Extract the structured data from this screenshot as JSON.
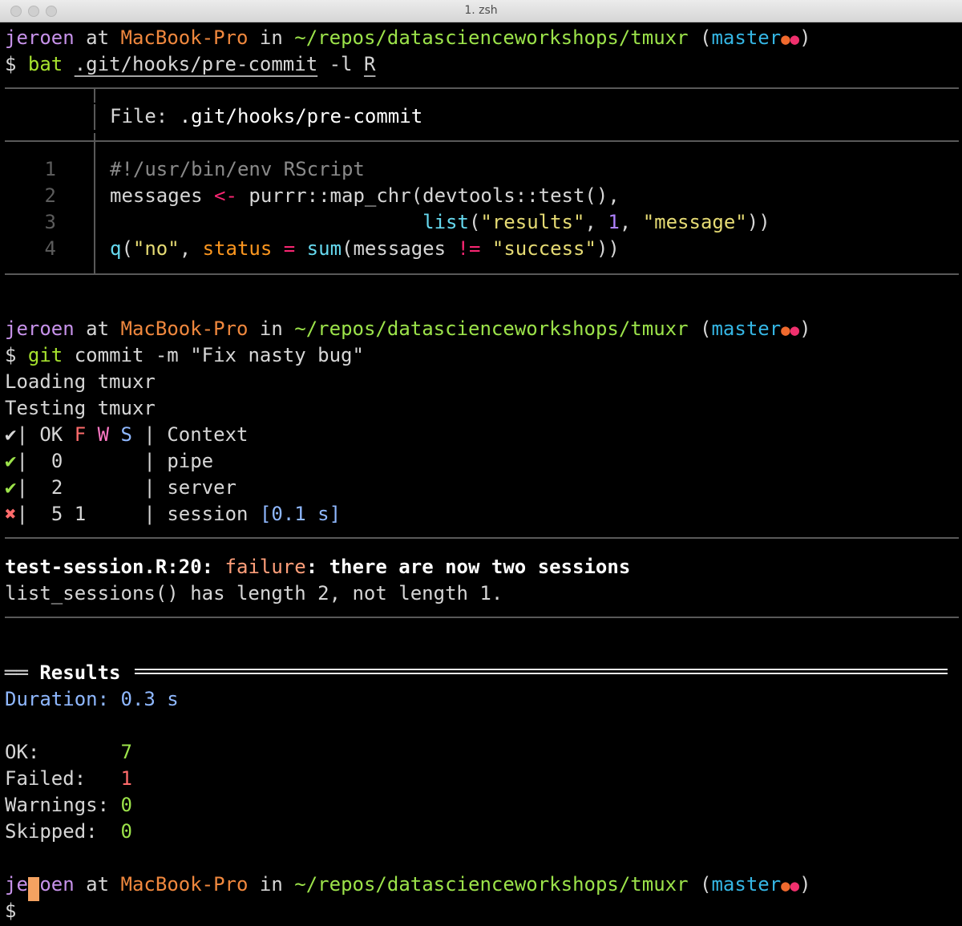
{
  "window": {
    "title": "1. zsh"
  },
  "prompt": {
    "user": "jeroen",
    "at": "at",
    "host": "MacBook-Pro",
    "in": "in",
    "path": "~/repos/datascienceworkshops/tmuxr",
    "paren_open": "(",
    "branch": "master",
    "dot1": "●",
    "dot2": "●",
    "paren_close": ")",
    "symbol": "$"
  },
  "bat_command": {
    "cmd": "bat",
    "file": ".git/hooks/pre-commit",
    "flag": "-l",
    "lang": "R"
  },
  "bat_output": {
    "header_label": "File:",
    "header_file": ".git/hooks/pre-commit",
    "line_numbers": [
      "1",
      "2",
      "3",
      "4"
    ],
    "line1": "#!/usr/bin/env RScript",
    "line2": {
      "a": "messages ",
      "op": "<-",
      "b": " purrr::map_chr(devtools::test(),"
    },
    "line3": {
      "indent": "                           ",
      "fn": "list",
      "a": "(",
      "s1": "\"results\"",
      "b": ", ",
      "n": "1",
      "c": ", ",
      "s2": "\"message\"",
      "d": "))"
    },
    "line4": {
      "fn1": "q",
      "a": "(",
      "s1": "\"no\"",
      "b": ", ",
      "param": "status",
      "c": " ",
      "eq": "=",
      "d": " ",
      "fn2": "sum",
      "e": "(messages ",
      "op": "!=",
      "f": " ",
      "s2": "\"success\"",
      "g": "))"
    }
  },
  "git_command": {
    "cmd": "git",
    "args": " commit -m \"Fix nasty bug\""
  },
  "test_output": {
    "loading": "Loading tmuxr",
    "testing": "Testing tmuxr",
    "header": {
      "check": "✔",
      "sep1": "| OK ",
      "f": "F",
      "w": "W",
      "s": "S",
      "sep2": " | Context"
    },
    "rows": [
      {
        "mark": "✔",
        "ok": "0",
        "fail": "",
        "context": "pipe",
        "time": ""
      },
      {
        "mark": "✔",
        "ok": "2",
        "fail": "",
        "context": "server",
        "time": ""
      },
      {
        "mark": "✖",
        "ok": "5",
        "fail": "1",
        "context": "session",
        "time": "[0.1 s]"
      }
    ],
    "failure_location": "test-session.R:20:",
    "failure_word": "failure",
    "failure_message": ": there are now two sessions",
    "failure_detail": "list_sessions() has length 2, not length 1.",
    "results_prefix": "══",
    "results_title": "Results",
    "duration_label": "Duration:",
    "duration_value": "0.3 s",
    "summary": [
      {
        "label": "OK:      ",
        "value": "7"
      },
      {
        "label": "Failed:  ",
        "value": "1"
      },
      {
        "label": "Warnings:",
        "value": "0"
      },
      {
        "label": "Skipped: ",
        "value": "0"
      }
    ]
  },
  "colors": {
    "background": "#000000",
    "user": "#c792ea",
    "host": "#f0883e",
    "path": "#9ce34a",
    "branch": "#35b6e4",
    "cursor": "#f4a261"
  }
}
